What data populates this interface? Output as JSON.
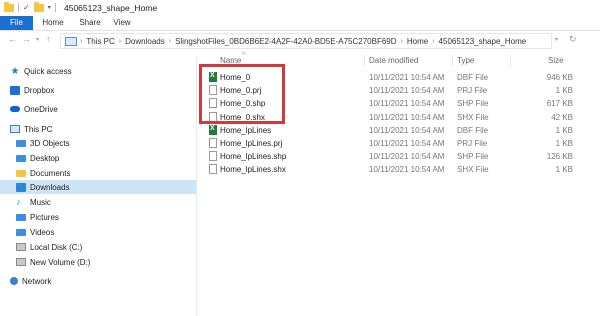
{
  "window": {
    "title": "45065123_shape_Home"
  },
  "ribbon": {
    "tabs": [
      "File",
      "Home",
      "Share",
      "View"
    ]
  },
  "address": {
    "segments": [
      "This PC",
      "Downloads",
      "SlingshotFiles_0BD6B6E2-4A2F-42A0-BD5E-A75C270BF69D",
      "Home",
      "45065123_shape_Home"
    ]
  },
  "columns": {
    "name": "Name",
    "date": "Date modified",
    "type": "Type",
    "size": "Size"
  },
  "sidebar": {
    "items": [
      {
        "label": "Quick access",
        "icon": "star-icon"
      },
      {
        "label": "Dropbox",
        "icon": "dropbox-icon"
      },
      {
        "label": "OneDrive",
        "icon": "cloud-icon"
      },
      {
        "label": "This PC",
        "icon": "computer-icon"
      },
      {
        "label": "3D Objects",
        "icon": "3d-objects-icon"
      },
      {
        "label": "Desktop",
        "icon": "desktop-icon"
      },
      {
        "label": "Documents",
        "icon": "documents-icon"
      },
      {
        "label": "Downloads",
        "icon": "downloads-icon"
      },
      {
        "label": "Music",
        "icon": "music-icon"
      },
      {
        "label": "Pictures",
        "icon": "pictures-icon"
      },
      {
        "label": "Videos",
        "icon": "videos-icon"
      },
      {
        "label": "Local Disk (C:)",
        "icon": "disk-icon"
      },
      {
        "label": "New Volume (D:)",
        "icon": "disk-icon"
      },
      {
        "label": "Network",
        "icon": "network-icon"
      }
    ],
    "selected": "Downloads"
  },
  "files": [
    {
      "name": "Home_0",
      "date": "10/11/2021 10:54 AM",
      "type": "DBF File",
      "size": "946 KB",
      "icon": "excel-file-icon"
    },
    {
      "name": "Home_0.prj",
      "date": "10/11/2021 10:54 AM",
      "type": "PRJ File",
      "size": "1 KB",
      "icon": "file-icon"
    },
    {
      "name": "Home_0.shp",
      "date": "10/11/2021 10:54 AM",
      "type": "SHP File",
      "size": "617 KB",
      "icon": "file-icon"
    },
    {
      "name": "Home_0.shx",
      "date": "10/11/2021 10:54 AM",
      "type": "SHX File",
      "size": "42 KB",
      "icon": "file-icon"
    },
    {
      "name": "Home_lpLines",
      "date": "10/11/2021 10:54 AM",
      "type": "DBF File",
      "size": "1 KB",
      "icon": "excel-file-icon"
    },
    {
      "name": "Home_lpLines.prj",
      "date": "10/11/2021 10:54 AM",
      "type": "PRJ File",
      "size": "1 KB",
      "icon": "file-icon"
    },
    {
      "name": "Home_lpLines.shp",
      "date": "10/11/2021 10:54 AM",
      "type": "SHP File",
      "size": "126 KB",
      "icon": "file-icon"
    },
    {
      "name": "Home_lpLines.shx",
      "date": "10/11/2021 10:54 AM",
      "type": "SHX File",
      "size": "1 KB",
      "icon": "file-icon"
    }
  ],
  "colors": {
    "accent": "#1a6fd1",
    "highlight_box": "#d2393d",
    "selection": "#cce4f7"
  }
}
